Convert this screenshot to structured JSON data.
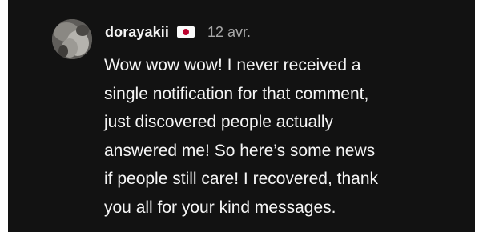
{
  "comment": {
    "author": {
      "username": "dorayakii",
      "flag_icon": "japan-flag-icon",
      "avatar_icon": "user-avatar-icon"
    },
    "timestamp": "12 avr.",
    "text_lines": [
      "Wow wow wow! I never received a",
      "single notification for that comment,",
      "just discovered people actually",
      "answered me! So here’s some news",
      "if people still care! I recovered, thank",
      "you all for your kind messages."
    ]
  },
  "colors": {
    "background": "#121212",
    "text_primary": "#f5f5f5",
    "text_secondary": "#a8a8a8",
    "flag_red": "#bc002d"
  }
}
